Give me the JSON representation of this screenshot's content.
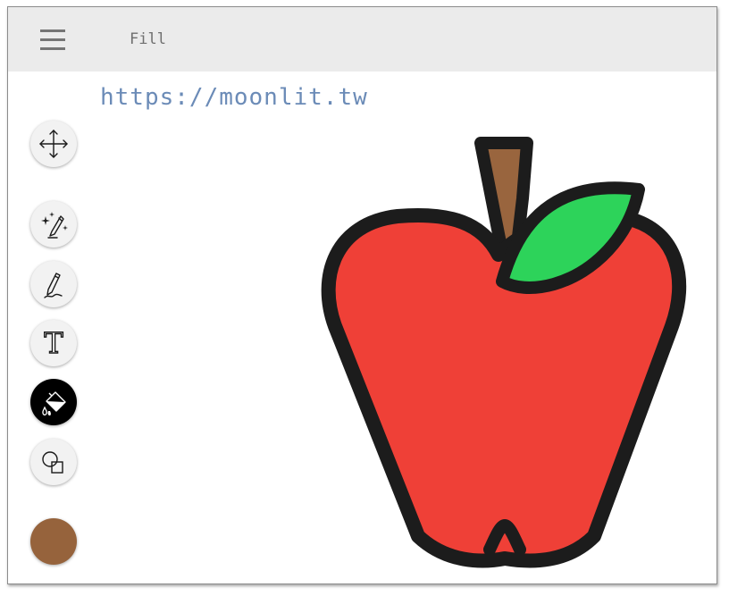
{
  "app": {
    "title": "Fill"
  },
  "watermark": {
    "url": "https://moonlit.tw"
  },
  "toolbar": {
    "tools": [
      {
        "name": "move",
        "icon": "move-arrows-icon",
        "active": false
      },
      {
        "name": "magic-draw",
        "icon": "magic-pencil-icon",
        "active": false
      },
      {
        "name": "draw",
        "icon": "pencil-icon",
        "active": false
      },
      {
        "name": "text",
        "icon": "text-icon",
        "glyph": "T",
        "active": false
      },
      {
        "name": "fill",
        "icon": "paint-bucket-icon",
        "active": true
      },
      {
        "name": "shapes",
        "icon": "shapes-icon",
        "active": false
      }
    ],
    "current_color": "#96633c"
  },
  "drawing": {
    "subject": "apple-drawing",
    "colors": {
      "apple_body": "#ef4037",
      "leaf": "#2dd35a",
      "stem": "#99653e",
      "outline": "#1c1c1c"
    }
  }
}
